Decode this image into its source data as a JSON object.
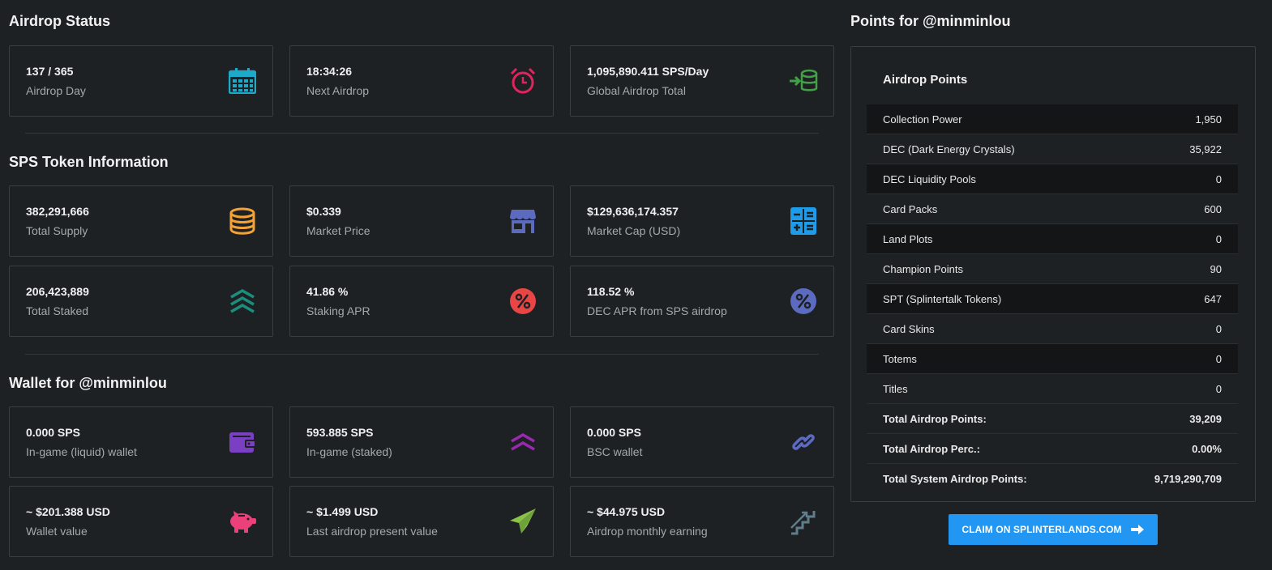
{
  "airdrop_status": {
    "title": "Airdrop Status",
    "cards": [
      {
        "value": "137 / 365",
        "label": "Airdrop Day",
        "icon": "calendar-icon",
        "color": "#1fa9c9"
      },
      {
        "value": "18:34:26",
        "label": "Next Airdrop",
        "icon": "alarm-clock-icon",
        "color": "#e0245e"
      },
      {
        "value": "1,095,890.411 SPS/Day",
        "label": "Global Airdrop Total",
        "icon": "database-import-icon",
        "color": "#43a047"
      }
    ]
  },
  "token_info": {
    "title": "SPS Token Information",
    "cards": [
      {
        "value": "382,291,666",
        "label": "Total Supply",
        "icon": "coins-stack-icon",
        "color": "#f4a235"
      },
      {
        "value": "$0.339",
        "label": "Market Price",
        "icon": "store-icon",
        "color": "#5c6bc0"
      },
      {
        "value": "$129,636,174.357",
        "label": "Market Cap (USD)",
        "icon": "calculator-icon",
        "color": "#1e9be9"
      },
      {
        "value": "206,423,889",
        "label": "Total Staked",
        "icon": "triple-chevron-up-icon",
        "color": "#1a8f7e"
      },
      {
        "value": "41.86 %",
        "label": "Staking APR",
        "icon": "percent-circle-icon",
        "color": "#e84545"
      },
      {
        "value": "118.52 %",
        "label": "DEC APR from SPS airdrop",
        "icon": "percent-circle-icon",
        "color": "#5c6bc0"
      }
    ]
  },
  "wallet": {
    "title": "Wallet for @minminlou",
    "cards": [
      {
        "value": "0.000 SPS",
        "label": "In-game (liquid) wallet",
        "icon": "wallet-icon",
        "color": "#7b3fc4"
      },
      {
        "value": "593.885 SPS",
        "label": "In-game (staked)",
        "icon": "double-chevron-up-icon",
        "color": "#9c27b0"
      },
      {
        "value": "0.000 SPS",
        "label": "BSC wallet",
        "icon": "link-icon",
        "color": "#5c6bc0"
      },
      {
        "value": "~ $201.388 USD",
        "label": "Wallet value",
        "icon": "piggy-bank-icon",
        "color": "#ec407a"
      },
      {
        "value": "~ $1.499 USD",
        "label": "Last airdrop present value",
        "icon": "paper-plane-icon",
        "color": "#8bc34a"
      },
      {
        "value": "~ $44.975 USD",
        "label": "Airdrop monthly earning",
        "icon": "stairs-icon",
        "color": "#607d8b"
      }
    ]
  },
  "points": {
    "title": "Points for @minminlou",
    "panel_title": "Airdrop Points",
    "rows": [
      {
        "label": "Collection Power",
        "value": "1,950"
      },
      {
        "label": "DEC (Dark Energy Crystals)",
        "value": "35,922"
      },
      {
        "label": "DEC Liquidity Pools",
        "value": "0"
      },
      {
        "label": "Card Packs",
        "value": "600"
      },
      {
        "label": "Land Plots",
        "value": "0"
      },
      {
        "label": "Champion Points",
        "value": "90"
      },
      {
        "label": "SPT (Splintertalk Tokens)",
        "value": "647"
      },
      {
        "label": "Card Skins",
        "value": "0"
      },
      {
        "label": "Totems",
        "value": "0"
      },
      {
        "label": "Titles",
        "value": "0"
      }
    ],
    "totals": [
      {
        "label": "Total Airdrop Points:",
        "value": "39,209"
      },
      {
        "label": "Total Airdrop Perc.:",
        "value": "0.00%"
      },
      {
        "label": "Total System Airdrop Points:",
        "value": "9,719,290,709"
      }
    ],
    "claim_label": "CLAIM ON SPLINTERLANDS.COM"
  }
}
